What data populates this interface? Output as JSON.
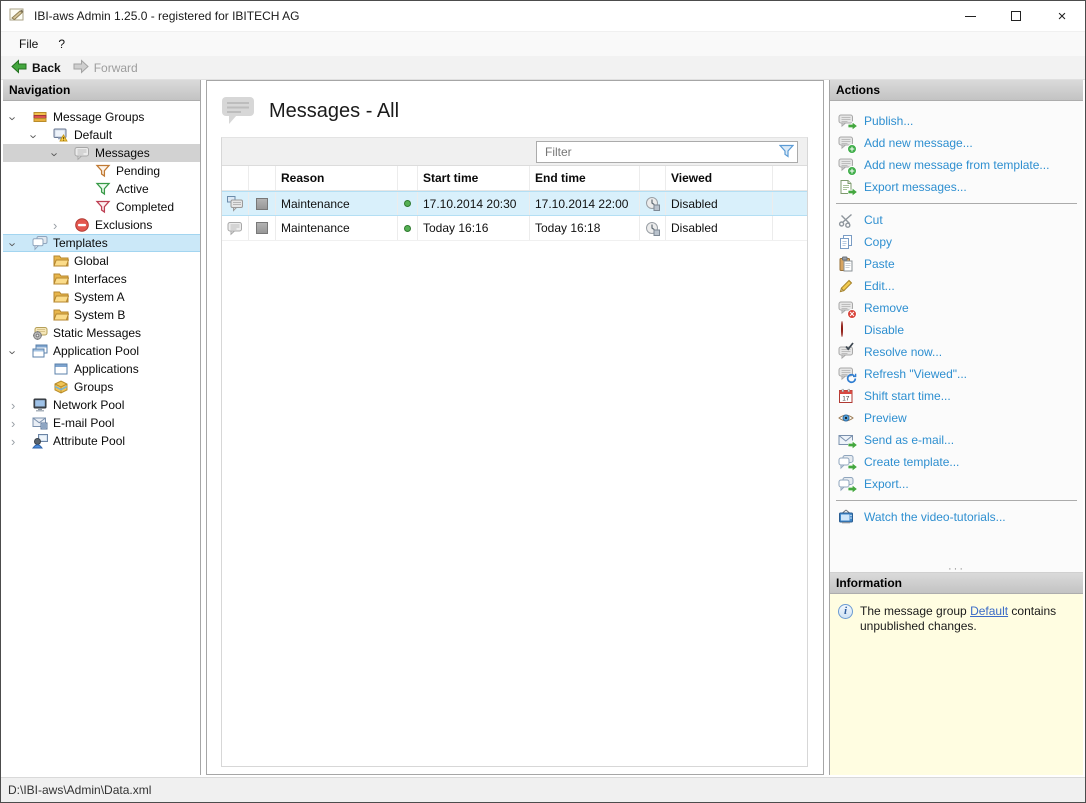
{
  "window": {
    "title": "IBI-aws Admin 1.25.0 - registered for IBITECH AG"
  },
  "menu": {
    "items": [
      {
        "label": "File"
      },
      {
        "label": "?"
      }
    ]
  },
  "toolbar": {
    "back_label": "Back",
    "forward_label": "Forward"
  },
  "navigation": {
    "header": "Navigation",
    "items": [
      {
        "label": "Message Groups",
        "icon": "message-groups-icon",
        "expanded": true
      },
      {
        "label": "Default",
        "icon": "group-monitor-warning-icon",
        "expanded": true
      },
      {
        "label": "Messages",
        "icon": "message-bubble-icon",
        "expanded": true,
        "selected": true
      },
      {
        "label": "Pending",
        "icon": "funnel-orange-icon"
      },
      {
        "label": "Active",
        "icon": "funnel-green-icon"
      },
      {
        "label": "Completed",
        "icon": "funnel-red-icon"
      },
      {
        "label": "Exclusions",
        "icon": "no-entry-icon",
        "expanded": false
      },
      {
        "label": "Templates",
        "icon": "templates-icon",
        "expanded": true,
        "highlighted": true
      },
      {
        "label": "Global",
        "icon": "folder-icon"
      },
      {
        "label": "Interfaces",
        "icon": "folder-icon"
      },
      {
        "label": "System A",
        "icon": "folder-icon"
      },
      {
        "label": "System B",
        "icon": "folder-icon"
      },
      {
        "label": "Static Messages",
        "icon": "static-messages-icon"
      },
      {
        "label": "Application Pool",
        "icon": "application-pool-icon",
        "expanded": true
      },
      {
        "label": "Applications",
        "icon": "application-window-icon"
      },
      {
        "label": "Groups",
        "icon": "package-icon"
      },
      {
        "label": "Network Pool",
        "icon": "monitor-icon",
        "expanded": false
      },
      {
        "label": "E-mail Pool",
        "icon": "envelope-icon",
        "expanded": false
      },
      {
        "label": "Attribute Pool",
        "icon": "person-computer-icon",
        "expanded": false
      }
    ]
  },
  "main": {
    "title": "Messages - All",
    "filter_placeholder": "Filter",
    "table": {
      "columns": [
        {
          "label": "Reason"
        },
        {
          "label": "Start time"
        },
        {
          "label": "End time"
        },
        {
          "label": "Viewed"
        }
      ],
      "rows": [
        {
          "reason": "Maintenance",
          "start_time": "17.10.2014 20:30",
          "end_time": "17.10.2014 22:00",
          "viewed": "Disabled",
          "selected": true
        },
        {
          "reason": "Maintenance",
          "start_time": "Today 16:16",
          "end_time": "Today 16:18",
          "viewed": "Disabled",
          "selected": false
        }
      ]
    }
  },
  "actions": {
    "header": "Actions",
    "groups": [
      {
        "items": [
          {
            "label": "Publish...",
            "icon": "publish-icon"
          },
          {
            "label": "Add new message...",
            "icon": "add-message-icon"
          },
          {
            "label": "Add new message from template...",
            "icon": "add-message-from-template-icon"
          },
          {
            "label": "Export messages...",
            "icon": "export-messages-icon"
          }
        ]
      },
      {
        "items": [
          {
            "label": "Cut",
            "icon": "cut-icon"
          },
          {
            "label": "Copy",
            "icon": "copy-icon"
          },
          {
            "label": "Paste",
            "icon": "paste-icon"
          },
          {
            "label": "Edit...",
            "icon": "edit-icon"
          },
          {
            "label": "Remove",
            "icon": "remove-icon"
          },
          {
            "label": "Disable",
            "icon": "disable-icon"
          },
          {
            "label": "Resolve now...",
            "icon": "resolve-icon"
          },
          {
            "label": "Refresh \"Viewed\"...",
            "icon": "refresh-viewed-icon"
          },
          {
            "label": "Shift start time...",
            "icon": "shift-start-time-icon"
          },
          {
            "label": "Preview",
            "icon": "preview-eye-icon"
          },
          {
            "label": "Send as e-mail...",
            "icon": "send-email-icon"
          },
          {
            "label": "Create template...",
            "icon": "create-template-icon"
          },
          {
            "label": "Export...",
            "icon": "export-icon"
          }
        ]
      },
      {
        "items": [
          {
            "label": "Watch the video-tutorials...",
            "icon": "video-tutorials-icon"
          }
        ]
      }
    ]
  },
  "information": {
    "header": "Information",
    "text_before": "The message group ",
    "link_label": "Default",
    "text_after": " contains unpublished changes."
  },
  "statusbar": {
    "path": "D:\\IBI-aws\\Admin\\Data.xml"
  },
  "colors": {
    "action_link": "#2e8fd0",
    "selected_row_bg": "#d9f0fb",
    "nav_selected_bg": "#d2d2d2",
    "nav_highlight_bg": "#cbe8f8",
    "info_bg": "#fffde1",
    "status_dot_green": "#55b054"
  }
}
